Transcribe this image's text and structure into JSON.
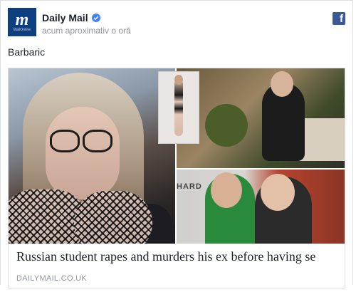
{
  "post": {
    "page_name": "Daily Mail",
    "avatar": {
      "main": "m",
      "sub": "MailOnline"
    },
    "verified_icon": "verified-badge-icon",
    "timestamp": "acum aproximativ o oră",
    "platform_icon": "facebook-icon",
    "platform_glyph": "f",
    "text": "Barbaric"
  },
  "link": {
    "headline": "Russian student rapes and murders his ex before having se",
    "domain": "DAILYMAIL.CO.UK",
    "image_caption_text": "HARD"
  },
  "colors": {
    "brand_blue": "#0c3e80",
    "facebook_blue": "#3b5998",
    "verified_blue": "#4080ff",
    "muted_text": "#90949c"
  }
}
